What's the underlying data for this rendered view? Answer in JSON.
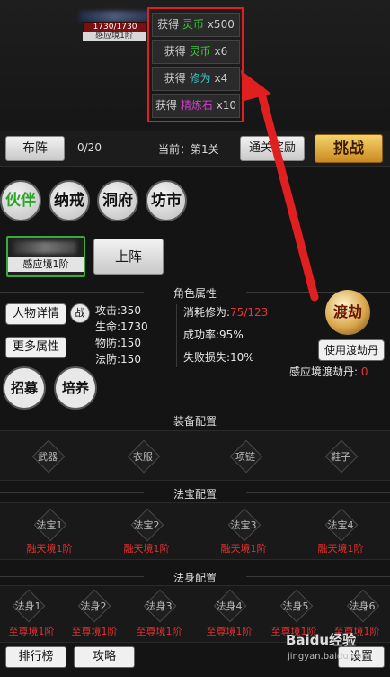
{
  "character": {
    "hp": "1730/1730",
    "realm": "感应境1阶"
  },
  "rewards": [
    {
      "prefix": "获得",
      "item": "灵币",
      "qty": "x500",
      "color": "green"
    },
    {
      "prefix": "获得",
      "item": "灵币",
      "qty": "x6",
      "color": "green"
    },
    {
      "prefix": "获得",
      "item": "修为",
      "qty": "x4",
      "color": "teal"
    },
    {
      "prefix": "获得",
      "item": "精炼石",
      "qty": "x10",
      "color": "pink"
    }
  ],
  "stage_bar": {
    "formation": "布阵",
    "count": "0/20",
    "current": "当前：第1关",
    "clear_reward": "通关奖励",
    "challenge": "挑战"
  },
  "nav": {
    "partner": "伙伴",
    "ring": "纳戒",
    "cave": "洞府",
    "market": "坊市"
  },
  "partner_slot": {
    "realm": "感应境1阶",
    "deploy": "上阵"
  },
  "attributes": {
    "section_title": "角色属性",
    "details": "人物详情",
    "battle": "战",
    "more": "更多属性",
    "recruit": "招募",
    "train": "培养",
    "attack": "攻击:350",
    "life": "生命:1730",
    "phys_def": "物防:150",
    "magic_def": "法防:150",
    "cost_label": "消耗修为:",
    "cost_value": "75/123",
    "success": "成功率:95%",
    "fail": "失败损失:10%",
    "dujie_icon": "渡劫",
    "use_pill": "使用渡劫丹",
    "pill_label": "感应境渡劫丹:",
    "pill_count": "0"
  },
  "equipment": {
    "section_title": "装备配置",
    "slots": [
      "武器",
      "衣服",
      "项链",
      "鞋子"
    ]
  },
  "treasures": {
    "section_title": "法宝配置",
    "slots": [
      {
        "name": "法宝1",
        "realm": "融天境1阶"
      },
      {
        "name": "法宝2",
        "realm": "融天境1阶"
      },
      {
        "name": "法宝3",
        "realm": "融天境1阶"
      },
      {
        "name": "法宝4",
        "realm": "融天境1阶"
      }
    ]
  },
  "bodies": {
    "section_title": "法身配置",
    "slots": [
      {
        "name": "法身1",
        "realm": "至尊境1阶"
      },
      {
        "name": "法身2",
        "realm": "至尊境1阶"
      },
      {
        "name": "法身3",
        "realm": "至尊境1阶"
      },
      {
        "name": "法身4",
        "realm": "至尊境1阶"
      },
      {
        "name": "法身5",
        "realm": "至尊境1阶"
      },
      {
        "name": "法身6",
        "realm": "至尊境1阶"
      }
    ]
  },
  "footer": {
    "ranking": "排行榜",
    "guide": "攻略",
    "settings": "设置"
  },
  "watermark": {
    "brand": "Baidu经验",
    "url": "jingyan.baidu.com"
  },
  "colors": {
    "highlight_red": "#e02020",
    "green": "#3ecf3e",
    "gold": "#f5d36a"
  }
}
